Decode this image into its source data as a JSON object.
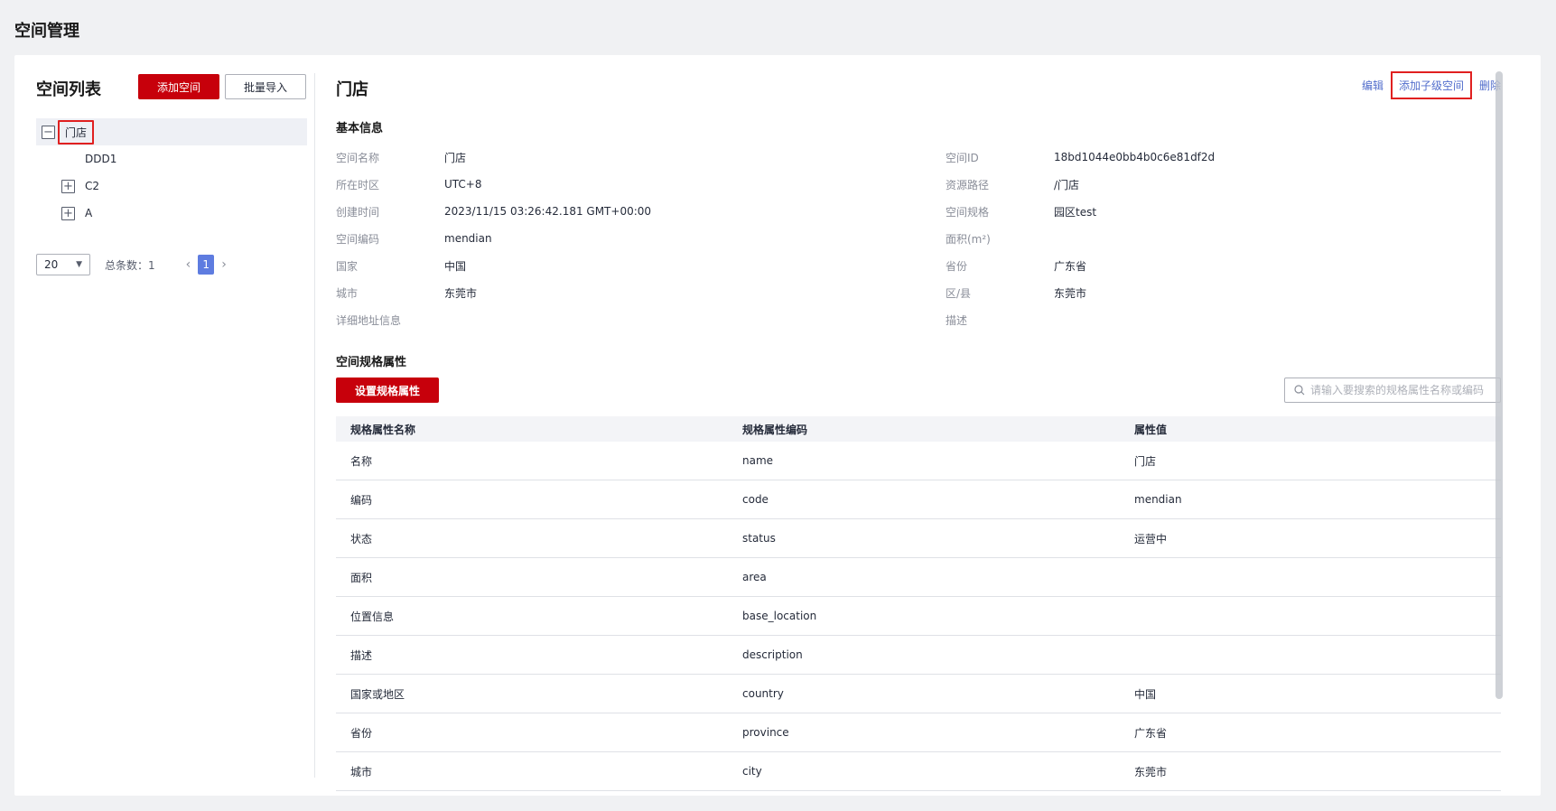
{
  "page_title": "空间管理",
  "left": {
    "title": "空间列表",
    "add_button": "添加空间",
    "import_button": "批量导入",
    "tree": {
      "root": {
        "label": "门店",
        "toggle": "−"
      },
      "children": [
        {
          "label": "DDD1"
        },
        {
          "label": "C2",
          "toggle": "+"
        },
        {
          "label": "A",
          "toggle": "+"
        }
      ]
    },
    "pager": {
      "page_size": "20",
      "total_label": "总条数：1",
      "current_page": "1",
      "prev": "‹",
      "next": "›"
    }
  },
  "detail": {
    "title": "门店",
    "actions": {
      "edit": "编辑",
      "add_child": "添加子级空间",
      "delete": "删除"
    },
    "basic_section": "基本信息",
    "basic_info": [
      {
        "l1": "空间名称",
        "v1": "门店",
        "l2": "空间ID",
        "v2": "18bd1044e0bb4b0c6e81df2d"
      },
      {
        "l1": "所在时区",
        "v1": "UTC+8",
        "l2": "资源路径",
        "v2": "/门店"
      },
      {
        "l1": "创建时间",
        "v1": "2023/11/15 03:26:42.181 GMT+00:00",
        "l2": "空间规格",
        "v2": "园区test"
      },
      {
        "l1": "空间编码",
        "v1": "mendian",
        "l2": "面积(m²)",
        "v2": ""
      },
      {
        "l1": "国家",
        "v1": "中国",
        "l2": "省份",
        "v2": "广东省"
      },
      {
        "l1": "城市",
        "v1": "东莞市",
        "l2": "区/县",
        "v2": "东莞市"
      },
      {
        "l1": "详细地址信息",
        "v1": "",
        "l2": "描述",
        "v2": ""
      }
    ],
    "spec_section": "空间规格属性",
    "set_attr_button": "设置规格属性",
    "search_placeholder": "请输入要搜索的规格属性名称或编码",
    "table": {
      "headers": [
        "规格属性名称",
        "规格属性编码",
        "属性值"
      ],
      "rows": [
        [
          "名称",
          "name",
          "门店"
        ],
        [
          "编码",
          "code",
          "mendian"
        ],
        [
          "状态",
          "status",
          "运营中"
        ],
        [
          "面积",
          "area",
          ""
        ],
        [
          "位置信息",
          "base_location",
          ""
        ],
        [
          "描述",
          "description",
          ""
        ],
        [
          "国家或地区",
          "country",
          "中国"
        ],
        [
          "省份",
          "province",
          "广东省"
        ],
        [
          "城市",
          "city",
          "东莞市"
        ]
      ]
    }
  }
}
